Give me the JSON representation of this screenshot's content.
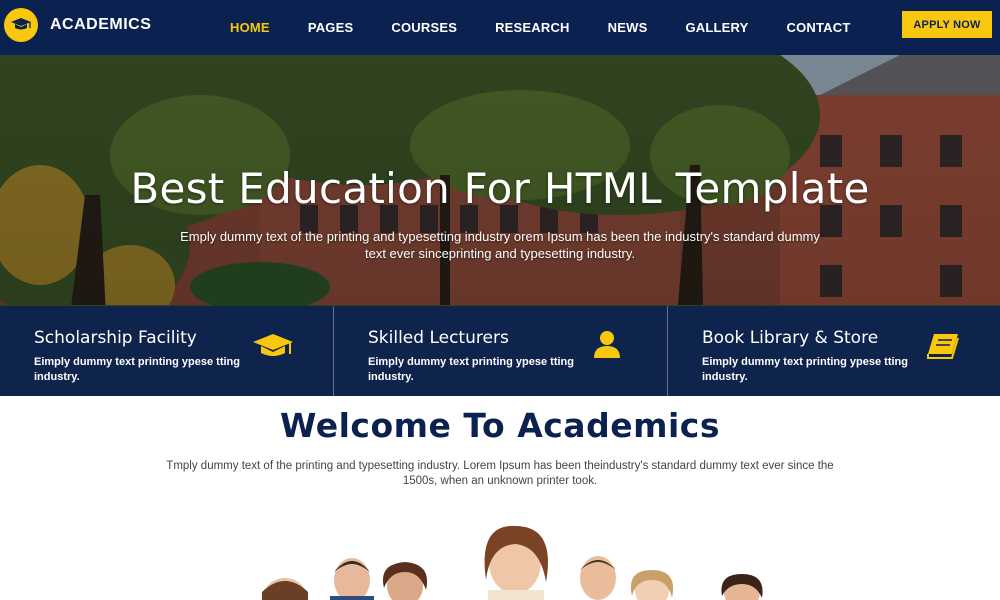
{
  "brand": {
    "name": "ACADEMICS",
    "icon": "graduation-cap-icon"
  },
  "nav": {
    "links": [
      "HOME",
      "PAGES",
      "COURSES",
      "RESEARCH",
      "NEWS",
      "GALLERY",
      "CONTACT"
    ],
    "active": "HOME",
    "apply_label": "APPLY NOW"
  },
  "hero": {
    "title": "Best Education For HTML Template",
    "subtitle": "Emply dummy text of the printing and typesetting industry orem Ipsum has been the industry's standard dummy text ever sinceprinting and typesetting industry."
  },
  "features": [
    {
      "title": "Scholarship Facility",
      "text": "Eimply dummy text printing ypese tting industry.",
      "icon": "graduation-cap-icon"
    },
    {
      "title": "Skilled Lecturers",
      "text": "Eimply dummy text printing ypese tting industry.",
      "icon": "user-icon"
    },
    {
      "title": "Book Library & Store",
      "text": "Eimply dummy text printing ypese tting industry.",
      "icon": "book-icon"
    }
  ],
  "welcome": {
    "title": "Welcome To Academics",
    "text": "Tmply dummy text of the printing and typesetting industry. Lorem Ipsum has been theindustry's standard dummy text ever since the 1500s, when an unknown printer took."
  },
  "colors": {
    "navy": "#0b2150",
    "accent": "#f9c80e",
    "text": "#444444"
  }
}
